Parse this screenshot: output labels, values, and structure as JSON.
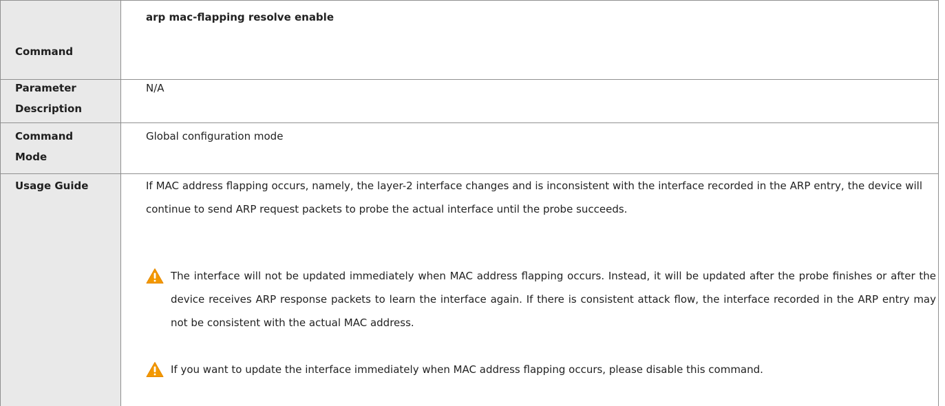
{
  "rows": {
    "command": {
      "label": "Command",
      "value": "arp mac-flapping resolve enable"
    },
    "parameter_description": {
      "label_line1": "Parameter",
      "label_line2": "Description",
      "value": "N/A"
    },
    "command_mode": {
      "label_line1": "Command",
      "label_line2": "Mode",
      "value": "Global configuration mode"
    },
    "usage_guide": {
      "label": "Usage Guide",
      "paragraph": "If MAC address flapping occurs, namely, the layer-2 interface changes and is inconsistent with the interface recorded in the ARP entry, the device will continue to send ARP request packets to probe the actual interface until the probe succeeds.",
      "cautions": [
        {
          "icon": "warning-triangle-icon",
          "text": "The interface will not be updated immediately when MAC address flapping occurs. Instead, it will be updated after the probe finishes or after the device receives ARP response packets to learn the interface again. If there is consistent attack flow, the interface recorded in the ARP entry may not be consistent with the actual MAC address."
        },
        {
          "icon": "warning-triangle-icon",
          "text": "If you want to update the interface immediately when MAC address flapping occurs, please disable this command."
        }
      ]
    }
  },
  "colors": {
    "label_background": "#e9e9e9",
    "border": "#8f8f8f",
    "text": "#222222",
    "caution_orange": "#f39800"
  }
}
